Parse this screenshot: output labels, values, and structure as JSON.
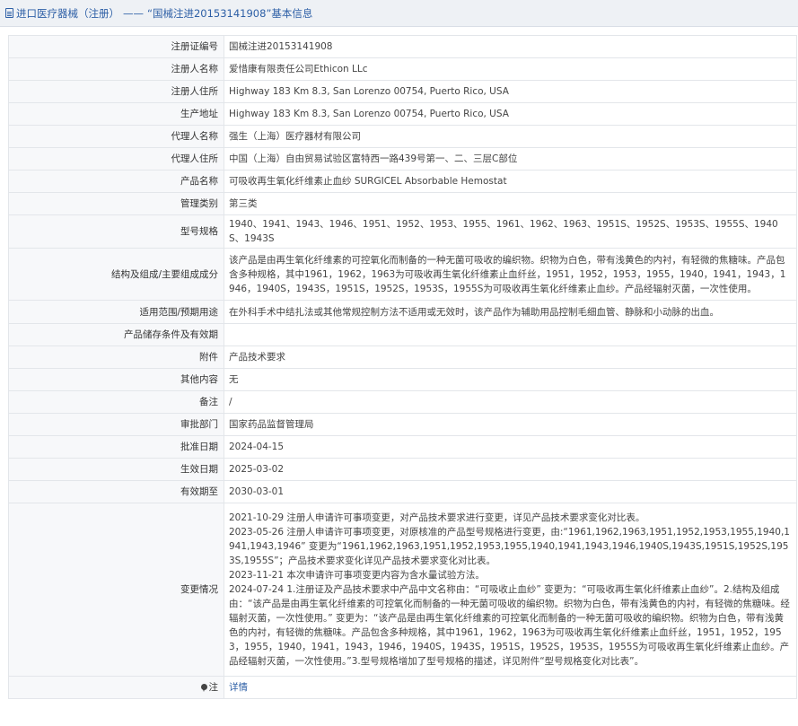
{
  "header": {
    "category": "进口医疗器械（注册）",
    "separator": "——",
    "title": "“国械注进20153141908”基本信息"
  },
  "rows": [
    {
      "label": "注册证编号",
      "value": "国械注进20153141908"
    },
    {
      "label": "注册人名称",
      "value": "爱惜康有限责任公司Ethicon LLc"
    },
    {
      "label": "注册人住所",
      "value": "Highway 183 Km 8.3, San Lorenzo 00754, Puerto Rico, USA"
    },
    {
      "label": "生产地址",
      "value": "Highway 183 Km 8.3, San Lorenzo 00754, Puerto Rico, USA"
    },
    {
      "label": "代理人名称",
      "value": "强生（上海）医疗器材有限公司"
    },
    {
      "label": "代理人住所",
      "value": "中国（上海）自由贸易试验区富特西一路439号第一、二、三层C部位"
    },
    {
      "label": "产品名称",
      "value": "可吸收再生氧化纤维素止血纱 SURGICEL Absorbable Hemostat"
    },
    {
      "label": "管理类别",
      "value": "第三类"
    },
    {
      "label": "型号规格",
      "value": "1940、1941、1943、1946、1951、1952、1953、1955、1961、1962、1963、1951S、1952S、1953S、1955S、1940S、1943S"
    },
    {
      "label": "结构及组成/主要组成成分",
      "value": "该产品是由再生氧化纤维素的可控氧化而制备的一种无菌可吸收的编织物。织物为白色，带有浅黄色的内衬，有轻微的焦糖味。产品包含多种规格，其中1961，1962，1963为可吸收再生氧化纤维素止血纤丝，1951，1952，1953，1955，1940，1941，1943，1946，1940S，1943S，1951S，1952S，1953S，1955S为可吸收再生氧化纤维素止血纱。产品经辐射灭菌，一次性使用。"
    },
    {
      "label": "适用范围/预期用途",
      "value": "在外科手术中结扎法或其他常规控制方法不适用或无效时，该产品作为辅助用品控制毛细血管、静脉和小动脉的出血。"
    },
    {
      "label": "产品储存条件及有效期",
      "value": ""
    },
    {
      "label": "附件",
      "value": "产品技术要求"
    },
    {
      "label": "其他内容",
      "value": "无"
    },
    {
      "label": "备注",
      "value": "/"
    },
    {
      "label": "审批部门",
      "value": "国家药品监督管理局"
    },
    {
      "label": "批准日期",
      "value": "2024-04-15"
    },
    {
      "label": "生效日期",
      "value": "2025-03-02"
    },
    {
      "label": "有效期至",
      "value": "2030-03-01"
    }
  ],
  "changes": {
    "label": "变更情况",
    "items": [
      "2021-10-29 注册人申请许可事项变更，对产品技术要求进行变更，详见产品技术要求变化对比表。",
      "2023-05-26 注册人申请许可事项变更，对原核准的产品型号规格进行变更，由:“1961,1962,1963,1951,1952,1953,1955,1940,1941,1943,1946” 变更为“1961,1962,1963,1951,1952,1953,1955,1940,1941,1943,1946,1940S,1943S,1951S,1952S,1953S,1955S”；产品技术要求变化详见产品技术要求变化对比表。",
      "2023-11-21 本次申请许可事项变更内容为含水量试验方法。",
      "2024-07-24 1.注册证及产品技术要求中产品中文名称由：“可吸收止血纱” 变更为：“可吸收再生氧化纤维素止血纱”。2.结构及组成由：“该产品是由再生氧化纤维素的可控氧化而制备的一种无菌可吸收的编织物。织物为白色，带有浅黄色的内衬，有轻微的焦糖味。经辐射灭菌，一次性使用。” 变更为：“该产品是由再生氧化纤维素的可控氧化而制备的一种无菌可吸收的编织物。织物为白色，带有浅黄色的内衬，有轻微的焦糖味。产品包含多种规格，其中1961，1962，1963为可吸收再生氧化纤维素止血纤丝，1951，1952，1953，1955，1940，1941，1943，1946，1940S，1943S，1951S，1952S，1953S，1955S为可吸收再生氧化纤维素止血纱。产品经辐射灭菌，一次性使用。”3.型号规格增加了型号规格的描述，详见附件“型号规格变化对比表”。"
    ]
  },
  "note": {
    "icon": "pin-icon",
    "label": "注",
    "link": "详情"
  },
  "colors": {
    "link": "#2d5fa6",
    "label_bg": "#f7f8fa",
    "border": "#e3e6ea",
    "header_bg": "#eef1f5"
  }
}
